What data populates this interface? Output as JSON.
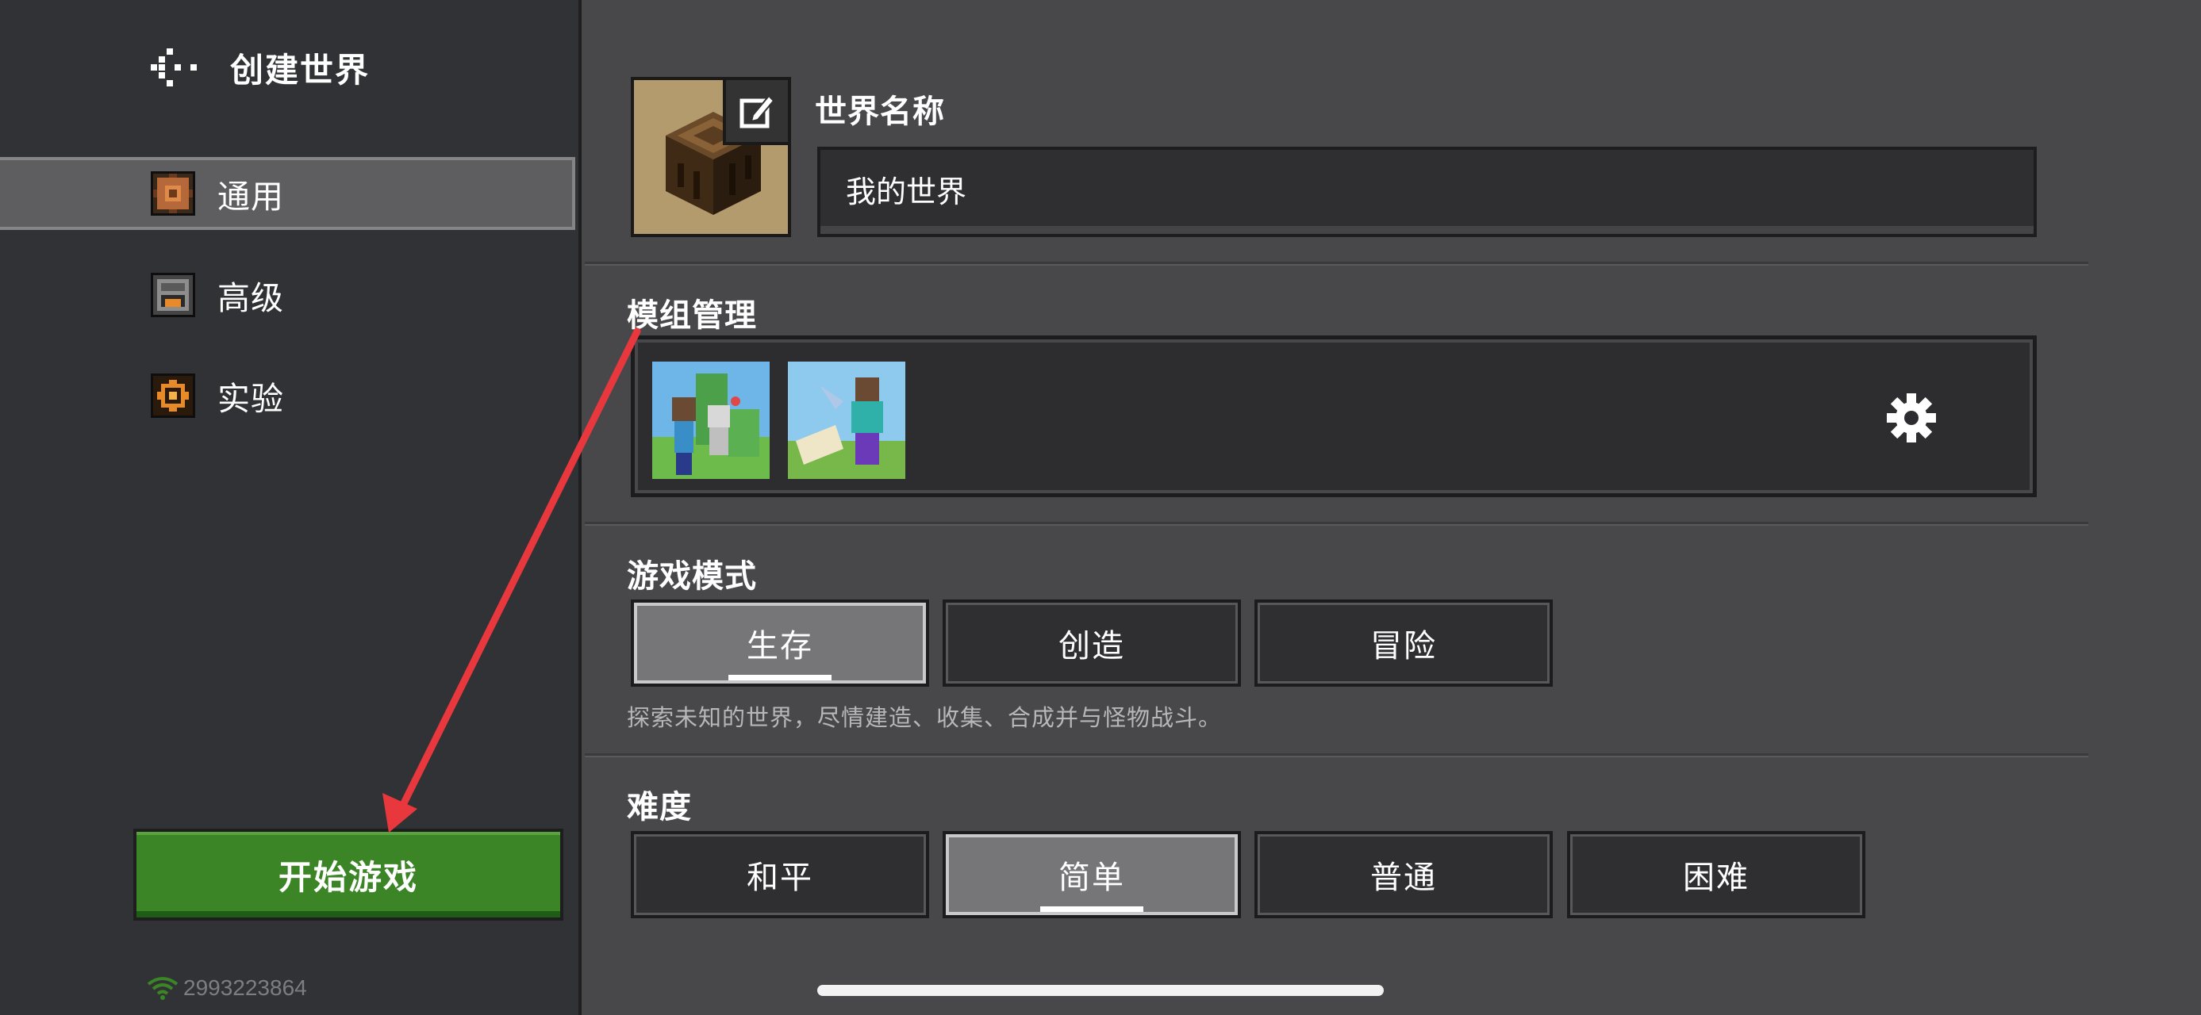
{
  "header": {
    "title": "创建世界"
  },
  "sidebar": {
    "items": [
      {
        "label": "通用",
        "icon": "general-icon",
        "active": true
      },
      {
        "label": "高级",
        "icon": "advanced-icon",
        "active": false
      },
      {
        "label": "实验",
        "icon": "experiments-icon",
        "active": false
      }
    ],
    "start_label": "开始游戏",
    "user_id": "2993223864"
  },
  "world": {
    "name_label": "世界名称",
    "name_value": "我的世界"
  },
  "mods": {
    "title": "模组管理"
  },
  "game_mode": {
    "title": "游戏模式",
    "options": [
      "生存",
      "创造",
      "冒险"
    ],
    "selected": "生存",
    "description": "探索未知的世界，尽情建造、收集、合成并与怪物战斗。"
  },
  "difficulty": {
    "title": "难度",
    "options": [
      "和平",
      "简单",
      "普通",
      "困难"
    ],
    "selected": "简单"
  },
  "colors": {
    "accent_green": "#3b8526",
    "annotation_red": "#e8383d"
  }
}
